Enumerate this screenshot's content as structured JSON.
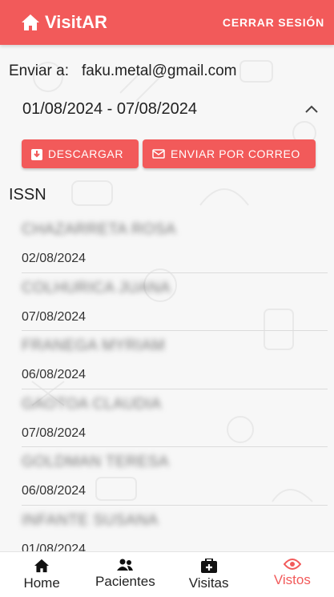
{
  "header": {
    "brand": "VisitAR",
    "logout_label": "CERRAR SESIÓN"
  },
  "email": {
    "label": "Enviar a:",
    "value": "faku.metal@gmail.com"
  },
  "date_range": "01/08/2024 - 07/08/2024",
  "actions": {
    "download_label": "DESCARGAR",
    "email_label": "ENVIAR POR CORREO"
  },
  "section_title": "ISSN",
  "items": [
    {
      "name": "CHAZARRETA ROSA",
      "date": "02/08/2024"
    },
    {
      "name": "COLHURICA JUANA",
      "date": "07/08/2024"
    },
    {
      "name": "FRANEGA MYRIAM",
      "date": "06/08/2024"
    },
    {
      "name": "GAOTOA CLAUDIA",
      "date": "07/08/2024"
    },
    {
      "name": "GOLDMAN TERESA",
      "date": "06/08/2024"
    },
    {
      "name": "INFANTE SUSANA",
      "date": "01/08/2024"
    }
  ],
  "nav": [
    {
      "label": "Home",
      "icon": "home-icon",
      "active": false
    },
    {
      "label": "Pacientes",
      "icon": "users-icon",
      "active": false
    },
    {
      "label": "Visitas",
      "icon": "medkit-icon",
      "active": false
    },
    {
      "label": "Vistos",
      "icon": "eye-icon",
      "active": true
    }
  ],
  "colors": {
    "accent": "#f25a5a",
    "background": "#f7f7f7"
  }
}
